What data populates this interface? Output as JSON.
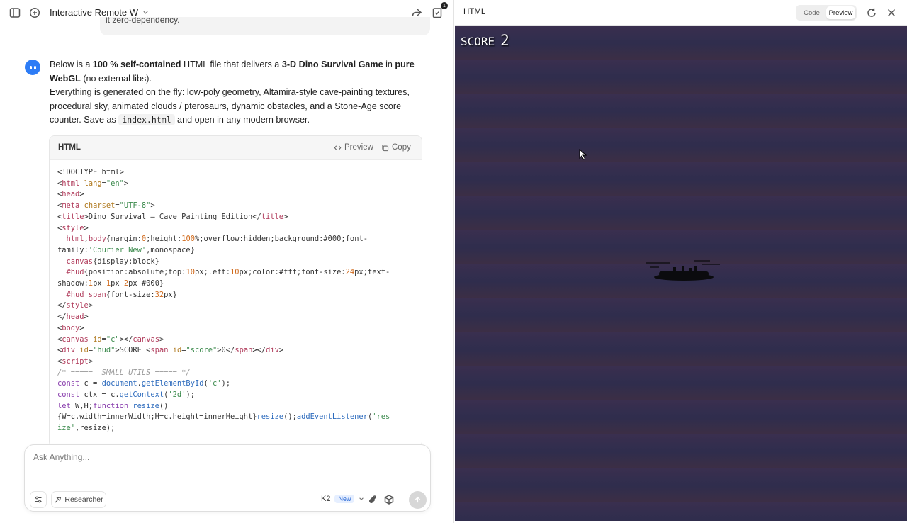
{
  "left": {
    "chat_title": "Interactive Remote W",
    "notification_count": "1",
    "prev_message_tail": "it zero-dependency.",
    "assistant": {
      "p1_a": "Below is a ",
      "p1_b": "100 % self-contained",
      "p1_c": " HTML file that delivers a ",
      "p1_d": "3-D Dino Survival Game",
      "p1_e": " in ",
      "p1_f": "pure WebGL",
      "p1_g": " (no external libs).",
      "p2_a": "Everything is generated on the fly: low-poly geometry, Altamira-style cave-painting textures, procedural sky, animated clouds / pterosaurs, dynamic obstacles, and a Stone-Age score counter.  Save as ",
      "p2_code": "index.html",
      "p2_b": " and open in any modern browser."
    },
    "code_block": {
      "language": "HTML",
      "preview_label": "Preview",
      "copy_label": "Copy"
    },
    "composer": {
      "placeholder": "Ask Anything...",
      "researcher_label": "Researcher",
      "model_label": "K2",
      "new_badge": "New"
    }
  },
  "right": {
    "title": "HTML",
    "code_tab": "Code",
    "preview_tab": "Preview",
    "hud_label": "SCORE",
    "score": "2"
  }
}
